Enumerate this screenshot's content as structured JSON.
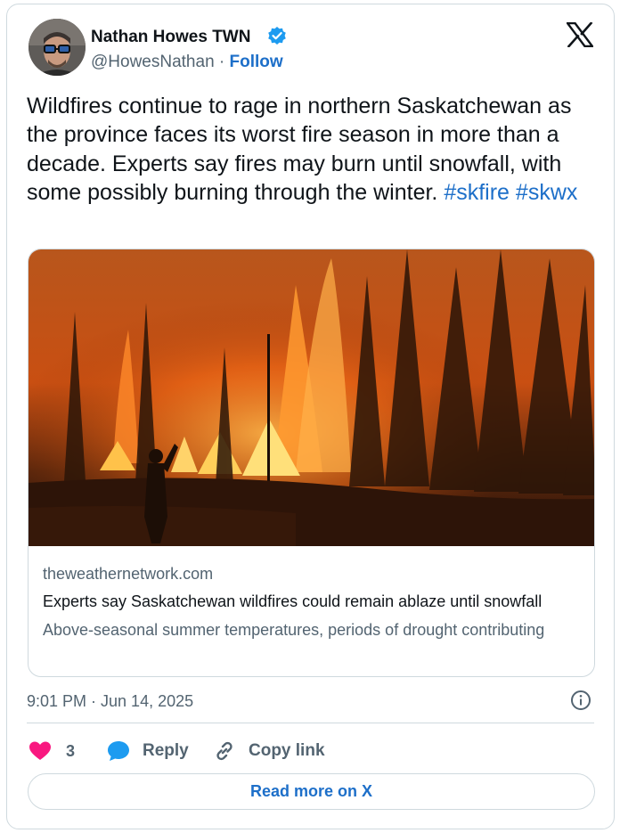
{
  "author": {
    "name": "Nathan Howes TWN",
    "handle": "@HowesNathan",
    "separator": "·",
    "follow_label": "Follow",
    "verified": true
  },
  "brand_icon": "x-logo-icon",
  "tweet": {
    "text": "Wildfires continue to rage in northern Saskatchewan as the province faces its worst fire season in more than a decade. Experts say fires may burn until snowfall, with some possibly burning through the winter. ",
    "hashtags": [
      "#skfire",
      "#skwx"
    ]
  },
  "link_card": {
    "domain": "theweathernetwork.com",
    "title": "Experts say Saskatchewan wildfires could remain ablaze until snowfall",
    "description": "Above-seasonal summer temperatures, periods of drought contributing"
  },
  "meta": {
    "timestamp": "9:01 PM · Jun 14, 2025"
  },
  "actions": {
    "like_count": "3",
    "reply_label": "Reply",
    "copy_label": "Copy link",
    "read_more_label": "Read more on X"
  },
  "colors": {
    "accent": "#1d6fc9",
    "verified": "#1d9bf0",
    "like": "#f91880",
    "secondary_text": "#536471",
    "border": "#cfd9de"
  }
}
